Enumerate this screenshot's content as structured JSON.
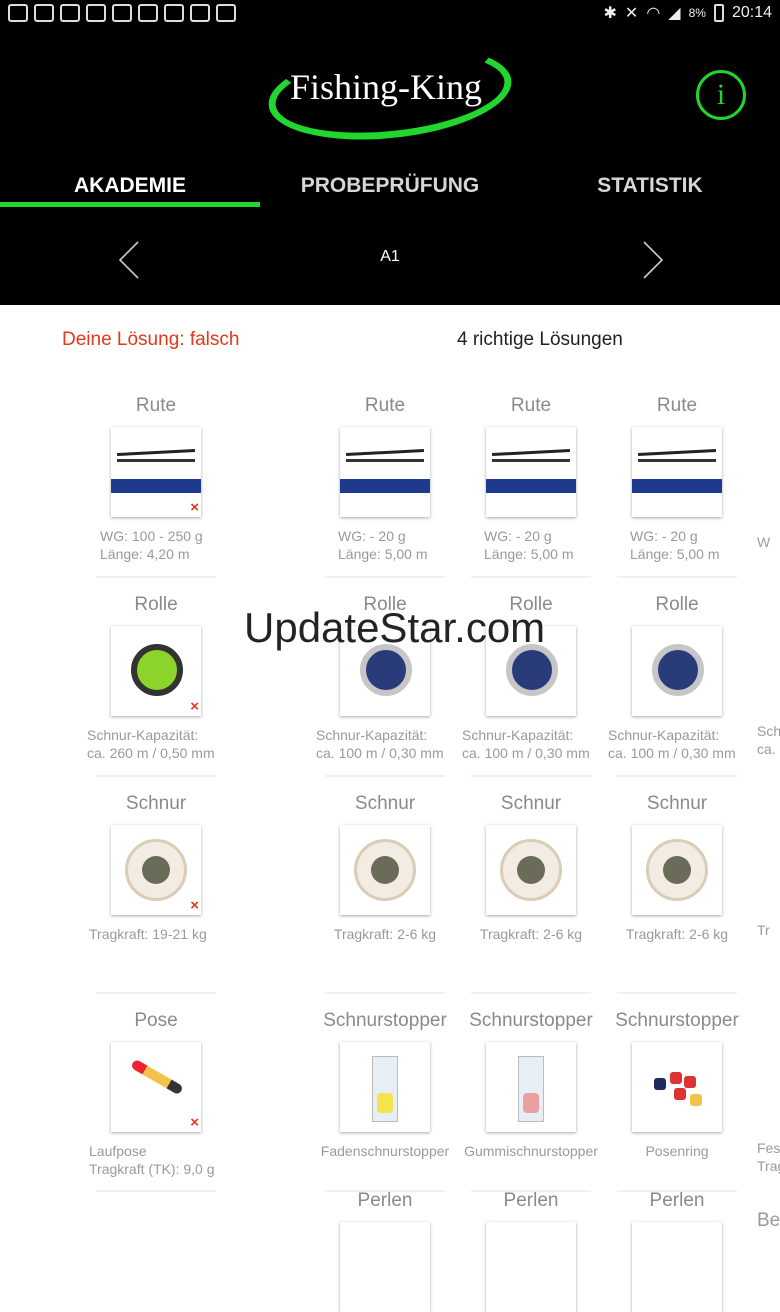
{
  "statusbar": {
    "battery": "8%",
    "time": "20:14"
  },
  "header": {
    "logo_text": "Fishing-King"
  },
  "tabs": [
    {
      "label": "AKADEMIE",
      "active": true
    },
    {
      "label": "PROBEPRÜFUNG",
      "active": false
    },
    {
      "label": "STATISTIK",
      "active": false
    }
  ],
  "nav": {
    "level": "A1"
  },
  "results": {
    "wrong": "Deine Lösung: falsch",
    "right": "4 richtige Lösungen"
  },
  "rows": [
    {
      "cells": [
        {
          "title": "Rute",
          "line1": "WG: 100 - 250 g",
          "line2": "Länge: 4,20 m",
          "wrong": true
        },
        {
          "title": "Rute",
          "line1": "WG: - 20 g",
          "line2": "Länge: 5,00 m"
        },
        {
          "title": "Rute",
          "line1": "WG: - 20 g",
          "line2": "Länge: 5,00 m"
        },
        {
          "title": "Rute",
          "line1": "WG: - 20 g",
          "line2": "Länge: 5,00 m"
        }
      ]
    },
    {
      "cells": [
        {
          "title": "Rolle",
          "line1": "Schnur-Kapazität:",
          "line2": "ca. 260 m / 0,50 mm",
          "wrong": true
        },
        {
          "title": "Rolle",
          "line1": "Schnur-Kapazität:",
          "line2": "ca. 100 m / 0,30 mm"
        },
        {
          "title": "Rolle",
          "line1": "Schnur-Kapazität:",
          "line2": "ca. 100 m / 0,30 mm"
        },
        {
          "title": "Rolle",
          "line1": "Schnur-Kapazität:",
          "line2": "ca. 100 m / 0,30 mm"
        }
      ]
    },
    {
      "cells": [
        {
          "title": "Schnur",
          "line1": "Tragkraft: 19-21 kg",
          "line2": "",
          "wrong": true
        },
        {
          "title": "Schnur",
          "line1": "Tragkraft: 2-6 kg",
          "line2": ""
        },
        {
          "title": "Schnur",
          "line1": "Tragkraft: 2-6 kg",
          "line2": ""
        },
        {
          "title": "Schnur",
          "line1": "Tragkraft: 2-6 kg",
          "line2": ""
        }
      ]
    },
    {
      "cells": [
        {
          "title": "Pose",
          "line1": "Laufpose",
          "line2": "Tragkraft (TK): 9,0 g",
          "wrong": true
        },
        {
          "title": "Schnurstopper",
          "line1": "Fadenschnurstopper",
          "line2": ""
        },
        {
          "title": "Schnurstopper",
          "line1": "Gummischnurstopper",
          "line2": ""
        },
        {
          "title": "Schnurstopper",
          "line1": "Posenring",
          "line2": ""
        }
      ]
    },
    {
      "cells": [
        {
          "title": "Perlen"
        },
        {
          "title": "Perlen"
        },
        {
          "title": "Perlen"
        }
      ]
    }
  ],
  "peek_right": [
    "W",
    "Sch",
    "ca.",
    "Tr",
    "Fes",
    "Trag",
    "Be"
  ],
  "wrong_mark": "×",
  "watermark": "UpdateStar.com",
  "colors": {
    "accent": "#21d62c",
    "wrong": "#e4361b",
    "header_bg": "#000000"
  }
}
